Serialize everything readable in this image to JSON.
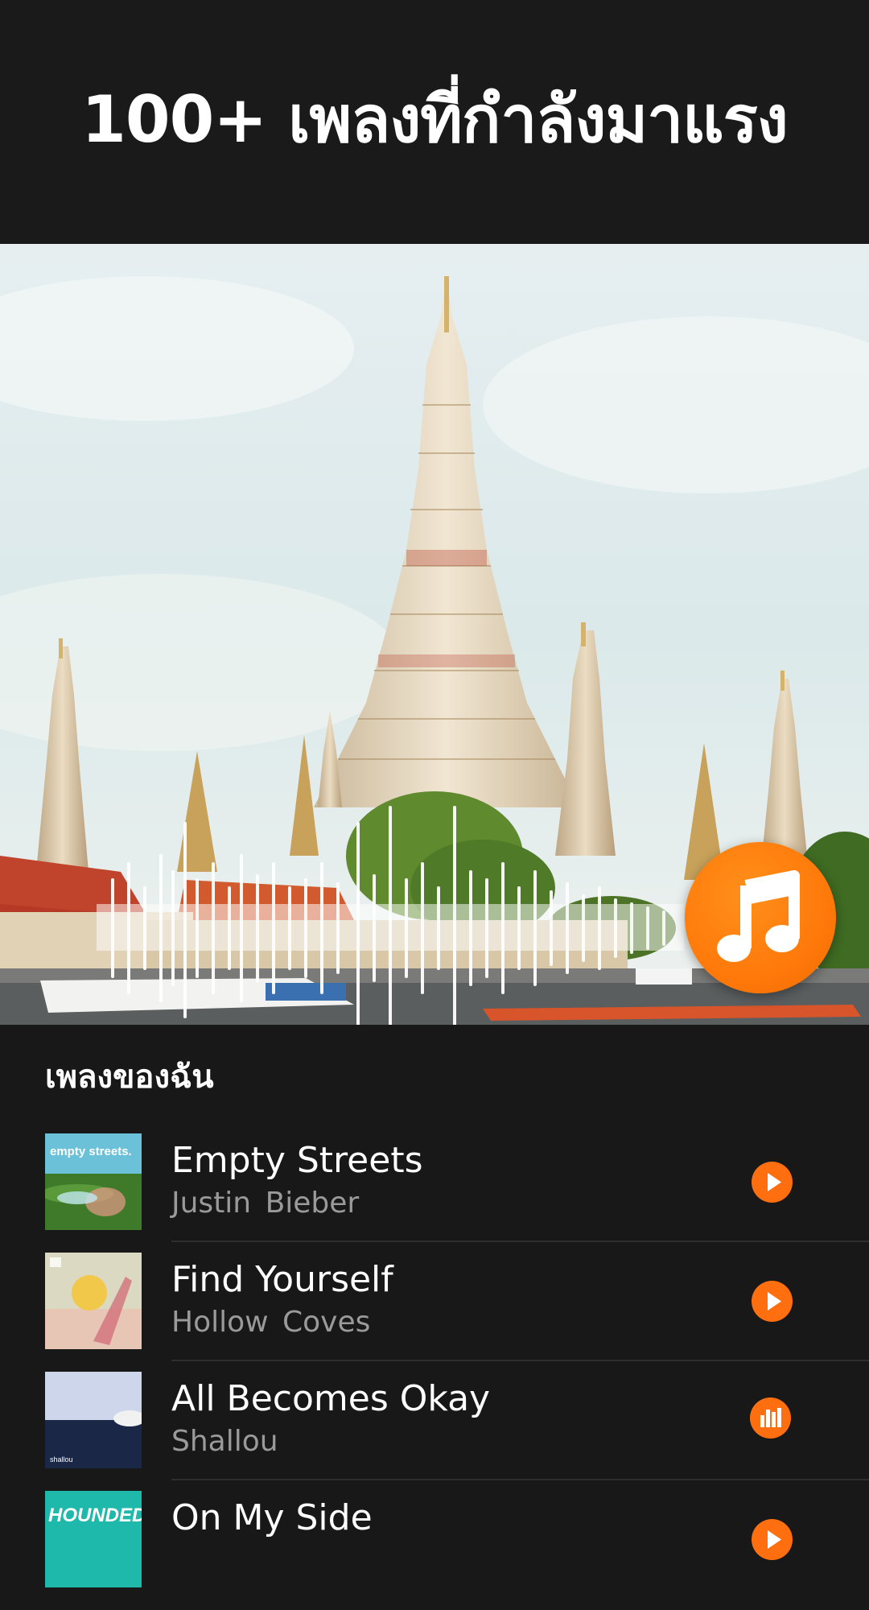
{
  "header": {
    "title": "100+ เพลงที่กำลังมาแรง"
  },
  "hero": {
    "image": "temple-photo",
    "overlay": "sound-waveform",
    "action_icon": "music-note-icon",
    "accent": "#ff7a0a"
  },
  "my_songs": {
    "title": "เพลงของฉัน",
    "tracks": [
      {
        "title": "Empty Streets",
        "artist": "Justin Bieber",
        "cover_text": "empty streets.",
        "state": "play",
        "icon": "play-icon"
      },
      {
        "title": "Find Yourself",
        "artist": "Hollow  Coves",
        "cover_text": "",
        "state": "play",
        "icon": "play-icon"
      },
      {
        "title": "All Becomes Okay",
        "artist": "Shallou",
        "cover_text": "shallou",
        "state": "playing",
        "icon": "equalizer-icon"
      },
      {
        "title": "On My Side",
        "artist": "",
        "cover_text": "HOUNDED",
        "state": "play",
        "icon": "play-icon"
      }
    ]
  }
}
